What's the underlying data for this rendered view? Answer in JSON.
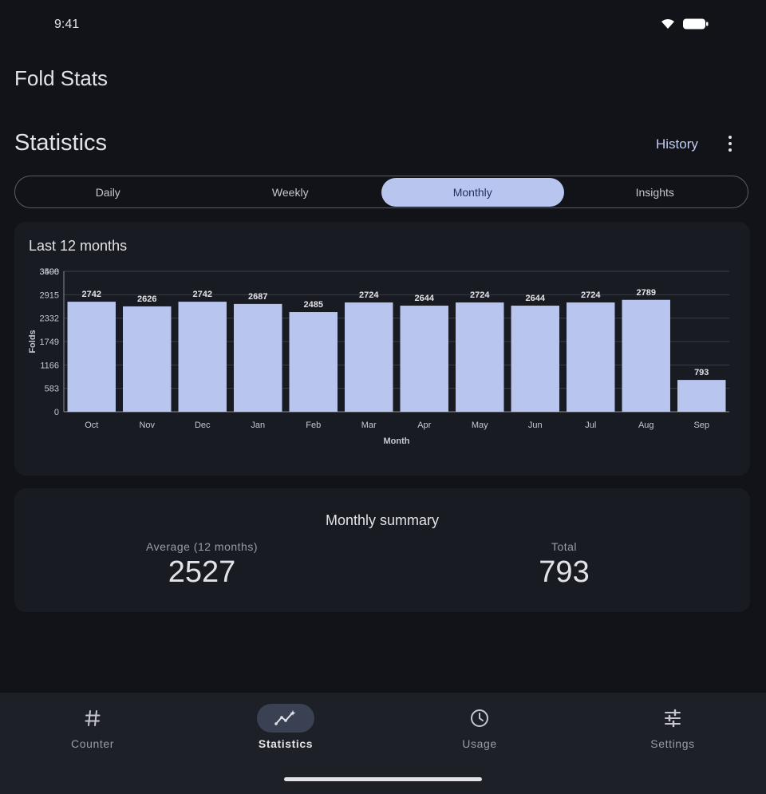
{
  "status": {
    "time": "9:41",
    "icons": [
      "wifi-icon",
      "battery-icon"
    ]
  },
  "app": {
    "title": "Fold Stats"
  },
  "header": {
    "title": "Statistics",
    "history_label": "History",
    "more_icon": "more-vert-icon"
  },
  "tabs": [
    {
      "label": "Daily",
      "active": false
    },
    {
      "label": "Weekly",
      "active": false
    },
    {
      "label": "Monthly",
      "active": true
    },
    {
      "label": "Insights",
      "active": false
    }
  ],
  "chart_card": {
    "title": "Last 12 months"
  },
  "chart_data": {
    "type": "bar",
    "categories": [
      "Oct",
      "Nov",
      "Dec",
      "Jan",
      "Feb",
      "Mar",
      "Apr",
      "May",
      "Jun",
      "Jul",
      "Aug",
      "Sep"
    ],
    "values": [
      2742,
      2626,
      2742,
      2687,
      2485,
      2724,
      2644,
      2724,
      2644,
      2724,
      2789,
      793
    ],
    "xlabel": "Month",
    "ylabel": "Folds",
    "yticks": [
      0,
      583,
      1166,
      1749,
      2332,
      2915,
      3498,
      3500
    ],
    "ylim": [
      0,
      3500
    ],
    "grid": true,
    "bar_color": "#b8c5ee"
  },
  "summary": {
    "title": "Monthly summary",
    "average_label": "Average (12 months)",
    "average_value": "2527",
    "total_label": "Total",
    "total_value": "793"
  },
  "nav": [
    {
      "label": "Counter",
      "icon": "hash-icon",
      "active": false
    },
    {
      "label": "Statistics",
      "icon": "trend-icon",
      "active": true
    },
    {
      "label": "Usage",
      "icon": "clock-icon",
      "active": false
    },
    {
      "label": "Settings",
      "icon": "sliders-icon",
      "active": false
    }
  ],
  "colors": {
    "background": "#111318",
    "card": "#181b21",
    "accent": "#b8c5ee",
    "nav_bg": "#1d2026"
  }
}
